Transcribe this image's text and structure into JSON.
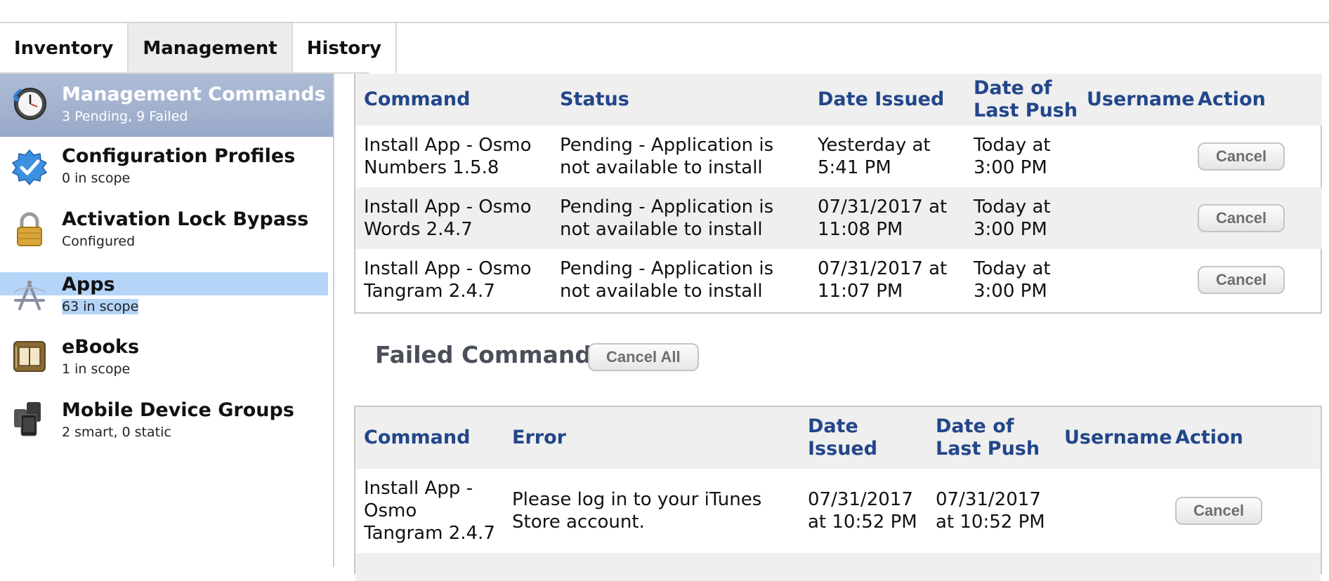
{
  "tabs": [
    {
      "label": "Inventory"
    },
    {
      "label": "Management"
    },
    {
      "label": "History"
    }
  ],
  "sidebar": {
    "items": [
      {
        "title": "Management Commands",
        "subtitle": "3 Pending, 9 Failed",
        "icon": "clock-icon"
      },
      {
        "title": "Configuration Profiles",
        "subtitle": "0 in scope",
        "icon": "badge-check-icon"
      },
      {
        "title": "Activation Lock Bypass",
        "subtitle": "Configured",
        "icon": "padlock-icon"
      },
      {
        "title": "Apps",
        "subtitle": "63 in scope",
        "icon": "app-store-icon"
      },
      {
        "title": "eBooks",
        "subtitle": "1 in scope",
        "icon": "ebook-icon"
      },
      {
        "title": "Mobile Device Groups",
        "subtitle": "2 smart, 0 static",
        "icon": "device-group-icon"
      }
    ]
  },
  "pending": {
    "columns": [
      "Command",
      "Status",
      "Date Issued",
      "Date of\nLast Push",
      "Username",
      "Action"
    ],
    "rows": [
      {
        "command": "Install App - Osmo\nNumbers 1.5.8",
        "status": "Pending - Application is\nnot available to install",
        "issued": "Yesterday at\n5:41 PM",
        "last_push": "Today at\n3:00 PM",
        "username": "",
        "action": "Cancel"
      },
      {
        "command": "Install App - Osmo\nWords 2.4.7",
        "status": "Pending - Application is\nnot available to install",
        "issued": "07/31/2017 at\n11:08 PM",
        "last_push": "Today at\n3:00 PM",
        "username": "",
        "action": "Cancel"
      },
      {
        "command": "Install App - Osmo\nTangram 2.4.7",
        "status": "Pending - Application is\nnot available to install",
        "issued": "07/31/2017 at\n11:07 PM",
        "last_push": "Today at\n3:00 PM",
        "username": "",
        "action": "Cancel"
      }
    ]
  },
  "failed": {
    "title": "Failed Commands",
    "cancel_all_label": "Cancel All",
    "columns": [
      "Command",
      "Error",
      "Date Issued",
      "Date of\nLast Push",
      "Username",
      "Action"
    ],
    "rows": [
      {
        "command": "Install App -\nOsmo\nTangram 2.4.7",
        "error": "Please log in to your iTunes\nStore account.",
        "issued": "07/31/2017\nat 10:52 PM",
        "last_push": "07/31/2017\nat 10:52 PM",
        "username": "",
        "action": "Cancel"
      }
    ]
  },
  "colors": {
    "header_text": "#22468a",
    "selected_bg": "#a5b5d1",
    "apps_highlight": "#b4d4f8"
  }
}
